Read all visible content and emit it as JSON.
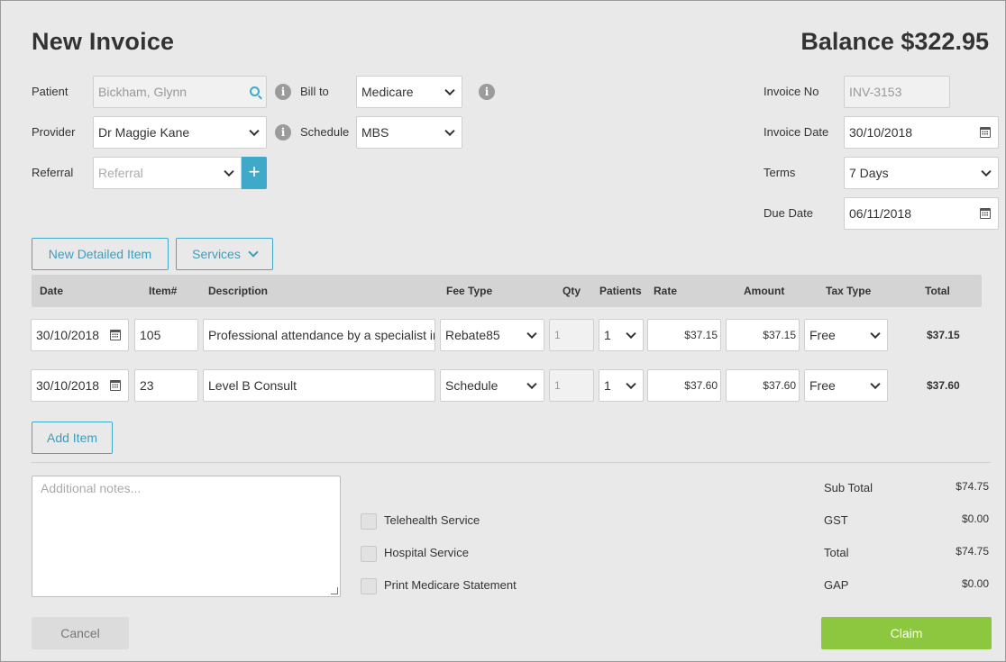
{
  "header": {
    "title": "New Invoice",
    "balance": "Balance $322.95"
  },
  "form": {
    "patient": {
      "label": "Patient",
      "value": "Bickham, Glynn"
    },
    "provider": {
      "label": "Provider",
      "value": "Dr Maggie Kane"
    },
    "referral": {
      "label": "Referral",
      "placeholder": "Referral"
    },
    "bill_to": {
      "label": "Bill to",
      "value": "Medicare"
    },
    "schedule": {
      "label": "Schedule",
      "value": "MBS"
    },
    "invoice_no": {
      "label": "Invoice No",
      "value": "INV-3153"
    },
    "invoice_date": {
      "label": "Invoice Date",
      "value": "30/10/2018"
    },
    "terms": {
      "label": "Terms",
      "value": "7 Days"
    },
    "due_date": {
      "label": "Due Date",
      "value": "06/11/2018"
    }
  },
  "actions": {
    "new_detailed_item": "New Detailed Item",
    "services": "Services",
    "add_item": "Add Item",
    "cancel": "Cancel",
    "claim": "Claim"
  },
  "table": {
    "columns": [
      "Date",
      "Item#",
      "Description",
      "Fee Type",
      "Qty",
      "Patients",
      "Rate",
      "Amount",
      "Tax Type",
      "Total"
    ],
    "rows": [
      {
        "date": "30/10/2018",
        "item": "105",
        "description": "Professional attendance by a specialist in",
        "fee_type": "Rebate85",
        "qty": "1",
        "patients": "1",
        "rate": "$37.15",
        "amount": "$37.15",
        "tax_type": "Free",
        "total": "$37.15"
      },
      {
        "date": "30/10/2018",
        "item": "23",
        "description": "Level B Consult",
        "fee_type": "Schedule",
        "qty": "1",
        "patients": "1",
        "rate": "$37.60",
        "amount": "$37.60",
        "tax_type": "Free",
        "total": "$37.60"
      }
    ]
  },
  "notes": {
    "placeholder": "Additional notes..."
  },
  "options": [
    {
      "label": "Telehealth Service",
      "checked": false
    },
    {
      "label": "Hospital Service",
      "checked": false
    },
    {
      "label": "Print Medicare Statement",
      "checked": false
    }
  ],
  "summary": [
    {
      "label": "Sub Total",
      "value": "$74.75"
    },
    {
      "label": "GST",
      "value": "$0.00"
    },
    {
      "label": "Total",
      "value": "$74.75"
    },
    {
      "label": "GAP",
      "value": "$0.00"
    }
  ],
  "colors": {
    "accent": "#3fa9c9",
    "claim": "#8dc63f",
    "background": "#e9e9e9"
  },
  "icons": {
    "patient_search": "search-icon",
    "info": "info-icon",
    "calendar": "calendar-icon",
    "add": "plus-icon"
  }
}
